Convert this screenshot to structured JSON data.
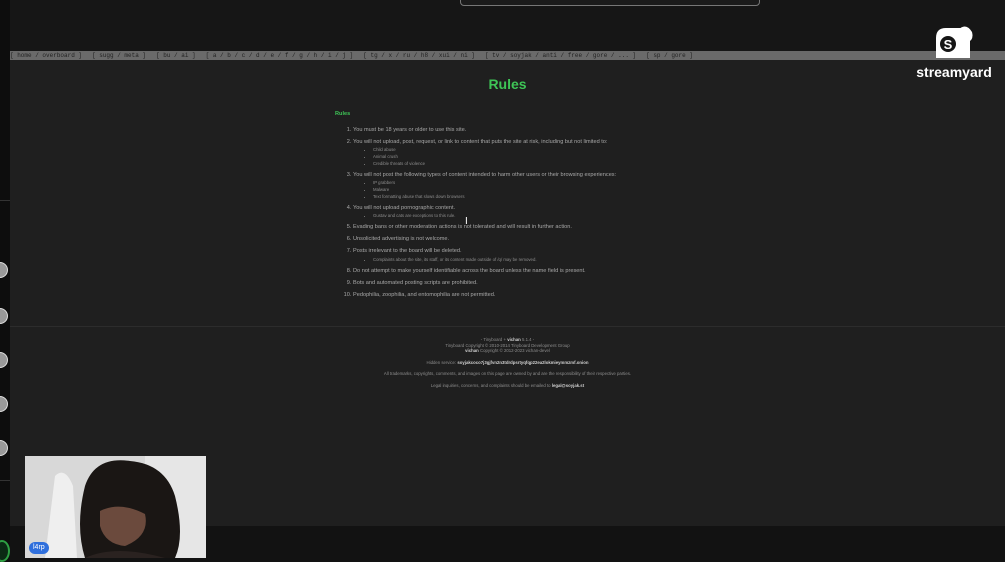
{
  "boardbar": {
    "items": [
      "[ home / overboard ]",
      "[ sugg / meta ]",
      "[ bu / ai ]",
      "[ a / b / c / d / e / f / g / h / i / j ]",
      "[ tg / x / ru / h8 / xui / ni ]",
      "[ tv / soyjak / anti / free / gore / ... ]",
      "[ sp / gore ]"
    ]
  },
  "page": {
    "title": "Rules",
    "heading": "Rules",
    "rules": [
      {
        "text": "You must be 18 years or older to use this site.",
        "sub": []
      },
      {
        "text": "You will not upload, post, request, or link to content that puts the site at risk, including but not limited to:",
        "sub": [
          "Child abuse",
          "Animal crush",
          "Credible threats of violence"
        ]
      },
      {
        "text": "You will not post the following types of content intended to harm other users or their browsing experiences:",
        "sub": [
          "IP grabbers",
          "Malware",
          "Text formatting abuse that slows down browsers"
        ]
      },
      {
        "text": "You will not upload pornographic content.",
        "sub": [
          "Gustav and cats are exceptions to this rule."
        ]
      },
      {
        "text": "Evading bans or other moderation actions is not tolerated and will result in further action.",
        "sub": []
      },
      {
        "text": "Unsolicited advertising is not welcome.",
        "sub": []
      },
      {
        "text": "Posts irrelevant to the board will be deleted.",
        "sub": [
          "Complaints about the site, its staff, or its content made outside of /q/ may be removed."
        ]
      },
      {
        "text": "Do not attempt to make yourself identifiable across the board unless the name field is present.",
        "sub": []
      },
      {
        "text": "Bots and automated posting scripts are prohibited.",
        "sub": []
      },
      {
        "text": "Pedophilia, zoophilia, and entomophilia are not permitted.",
        "sub": []
      }
    ]
  },
  "footer": {
    "line1_pre": "- Tinyboard +",
    "line1_bold": "vichan",
    "line1_post": "5.1.4 -",
    "line2": "Tinyboard Copyright © 2010-2014 Tinyboard Development Group",
    "line3_bold": "vichan",
    "line3_post": "Copyright © 2012-2023 vichan-devel",
    "hidden_label": "Hidden service:",
    "hidden_value": "soyjakcoco7j3gjfvn2n3tdrdpsrtyqfqp22ea2lokmieymmzmf.onion",
    "notice": "All trademarks, copyrights, comments, and images on this page are owned by and are the responsibility of their respective parties.",
    "legal_pre": "Legal inquiries, concerns, and complaints should be emailed to",
    "legal_email": "legal@soyjak.st"
  },
  "brand": {
    "name": "streamyard"
  },
  "webcam": {
    "name": "l4rp"
  },
  "colors": {
    "accent_green": "#3ec456",
    "streamyard_white": "#ffffff",
    "name_tag_blue": "#2f6fdc"
  }
}
